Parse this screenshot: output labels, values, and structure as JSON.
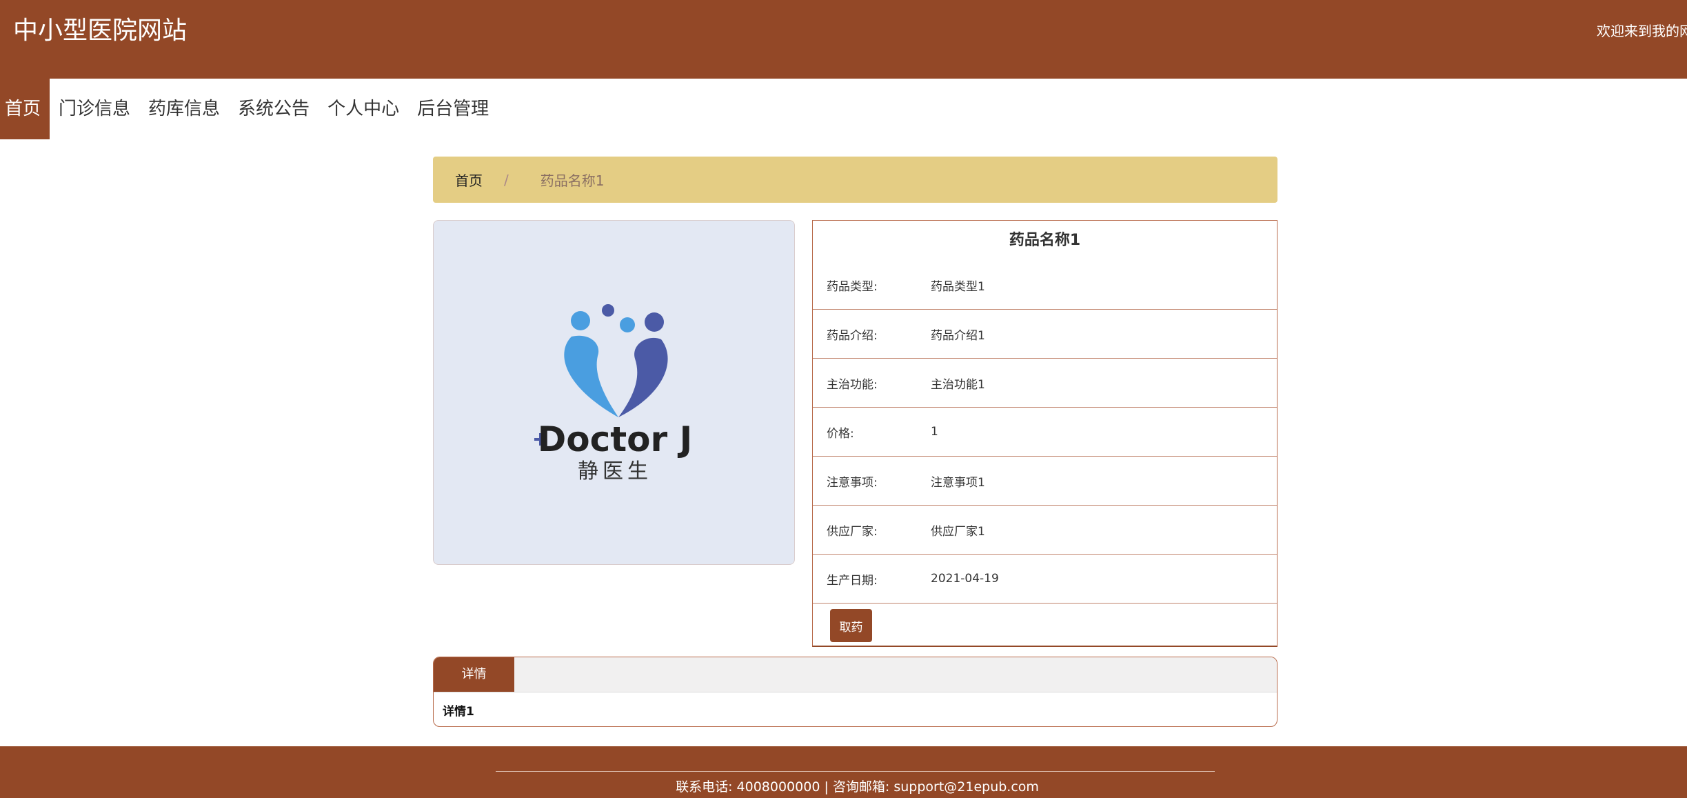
{
  "header": {
    "site_title": "中小型医院网站",
    "welcome": "欢迎来到我的网"
  },
  "nav": {
    "items": [
      {
        "label": "首页",
        "active": true
      },
      {
        "label": "门诊信息"
      },
      {
        "label": "药库信息"
      },
      {
        "label": "系统公告"
      },
      {
        "label": "个人中心"
      },
      {
        "label": "后台管理"
      }
    ]
  },
  "breadcrumb": {
    "home": "首页",
    "separator": "/",
    "current": "药品名称1"
  },
  "image": {
    "logo_text": "Doctor J",
    "logo_subtext": "静医生",
    "icon": "doctor-j-logo"
  },
  "product": {
    "title": "药品名称1",
    "fields": [
      {
        "label": "药品类型:",
        "value": "药品类型1"
      },
      {
        "label": "药品介绍:",
        "value": "药品介绍1"
      },
      {
        "label": "主治功能:",
        "value": "主治功能1"
      },
      {
        "label": "价格:",
        "value": "1"
      },
      {
        "label": "注意事项:",
        "value": "注意事项1"
      },
      {
        "label": "供应厂家:",
        "value": "供应厂家1"
      },
      {
        "label": "生产日期:",
        "value": "2021-04-19"
      }
    ],
    "action_label": "取药"
  },
  "detail": {
    "tab_label": "详情",
    "content": "详情1"
  },
  "footer": {
    "text": "联系电话: 4008000000 | 咨询邮箱: support@21epub.com"
  },
  "colors": {
    "brand": "#934827",
    "breadcrumb_bg": "#e4cd84",
    "image_bg": "#e3e8f3"
  }
}
